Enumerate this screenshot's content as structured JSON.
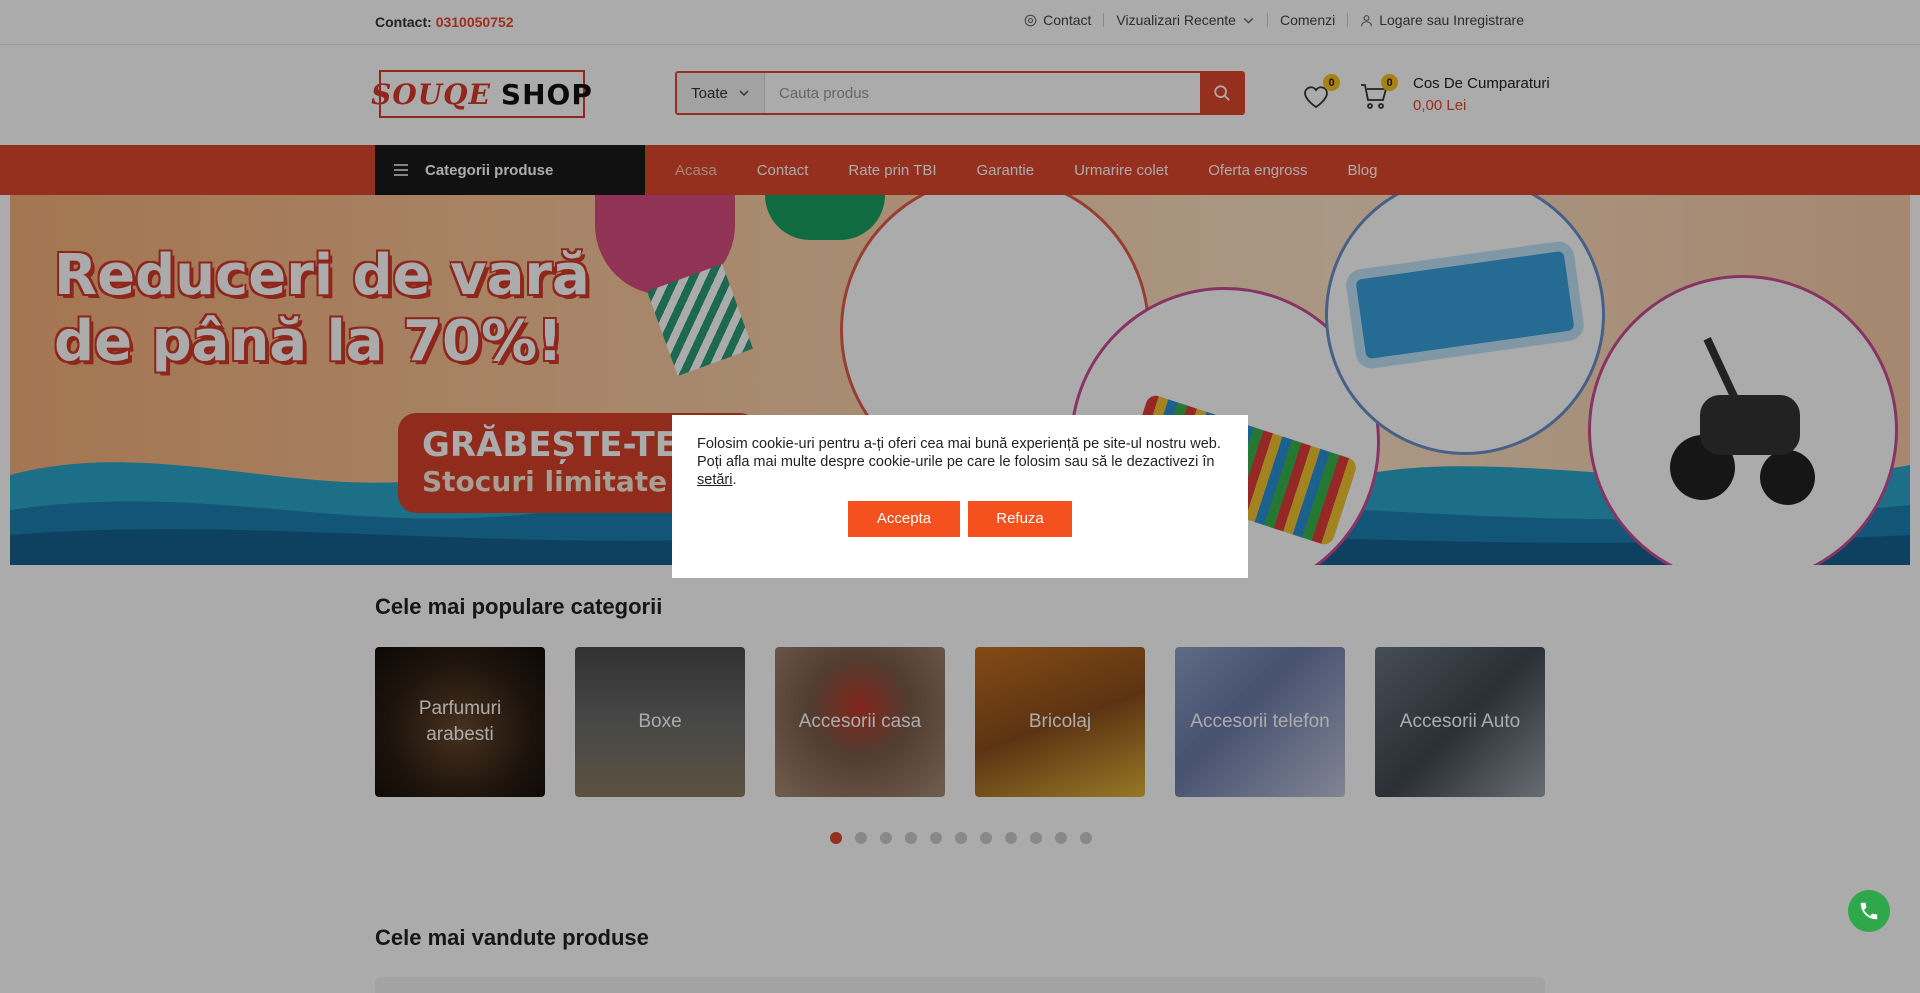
{
  "topbar": {
    "contact_label": "Contact",
    "contact_phone": "0310050752",
    "links": [
      "Contact",
      "Vizualizari Recente",
      "Comenzi",
      "Logare sau Inregistrare"
    ]
  },
  "header": {
    "logo_part1": "SOUQE",
    "logo_part2": "SHOP",
    "search_category": "Toate",
    "search_placeholder": "Cauta produs",
    "wishlist_count": "0",
    "cart_count": "0",
    "cart_title": "Cos De Cumparaturi",
    "cart_total": "0,00 Lei"
  },
  "nav": {
    "categories_label": "Categorii produse",
    "links": [
      "Acasa",
      "Contact",
      "Rate prin TBI",
      "Garantie",
      "Urmarire colet",
      "Oferta engross",
      "Blog"
    ]
  },
  "banner": {
    "title": "Reduceri de vară de până la 70%!",
    "cta_line1": "GRĂBEȘTE-TE!",
    "cta_line2": "Stocuri limitate"
  },
  "categories": {
    "title": "Cele mai populare categorii",
    "items": [
      {
        "label": "Parfumuri arabesti"
      },
      {
        "label": "Boxe"
      },
      {
        "label": "Accesorii casa"
      },
      {
        "label": "Bricolaj"
      },
      {
        "label": "Accesorii telefon"
      },
      {
        "label": "Accesorii Auto"
      }
    ]
  },
  "bestsellers": {
    "title": "Cele mai vandute produse"
  },
  "cookie": {
    "line1": "Folosim cookie-uri pentru a-ți oferi cea mai bună experiență pe site-ul nostru web.",
    "line2_prefix": "Poți afla mai multe despre cookie-urile pe care le folosim sau să le dezactivezi în",
    "settings_link": "setări",
    "accept": "Accepta",
    "refuse": "Refuza"
  },
  "colors": {
    "accent": "#e0482d",
    "nav_dark": "#1a1a1a",
    "badge": "#f6c21a",
    "phone_button": "#2ea84a"
  }
}
